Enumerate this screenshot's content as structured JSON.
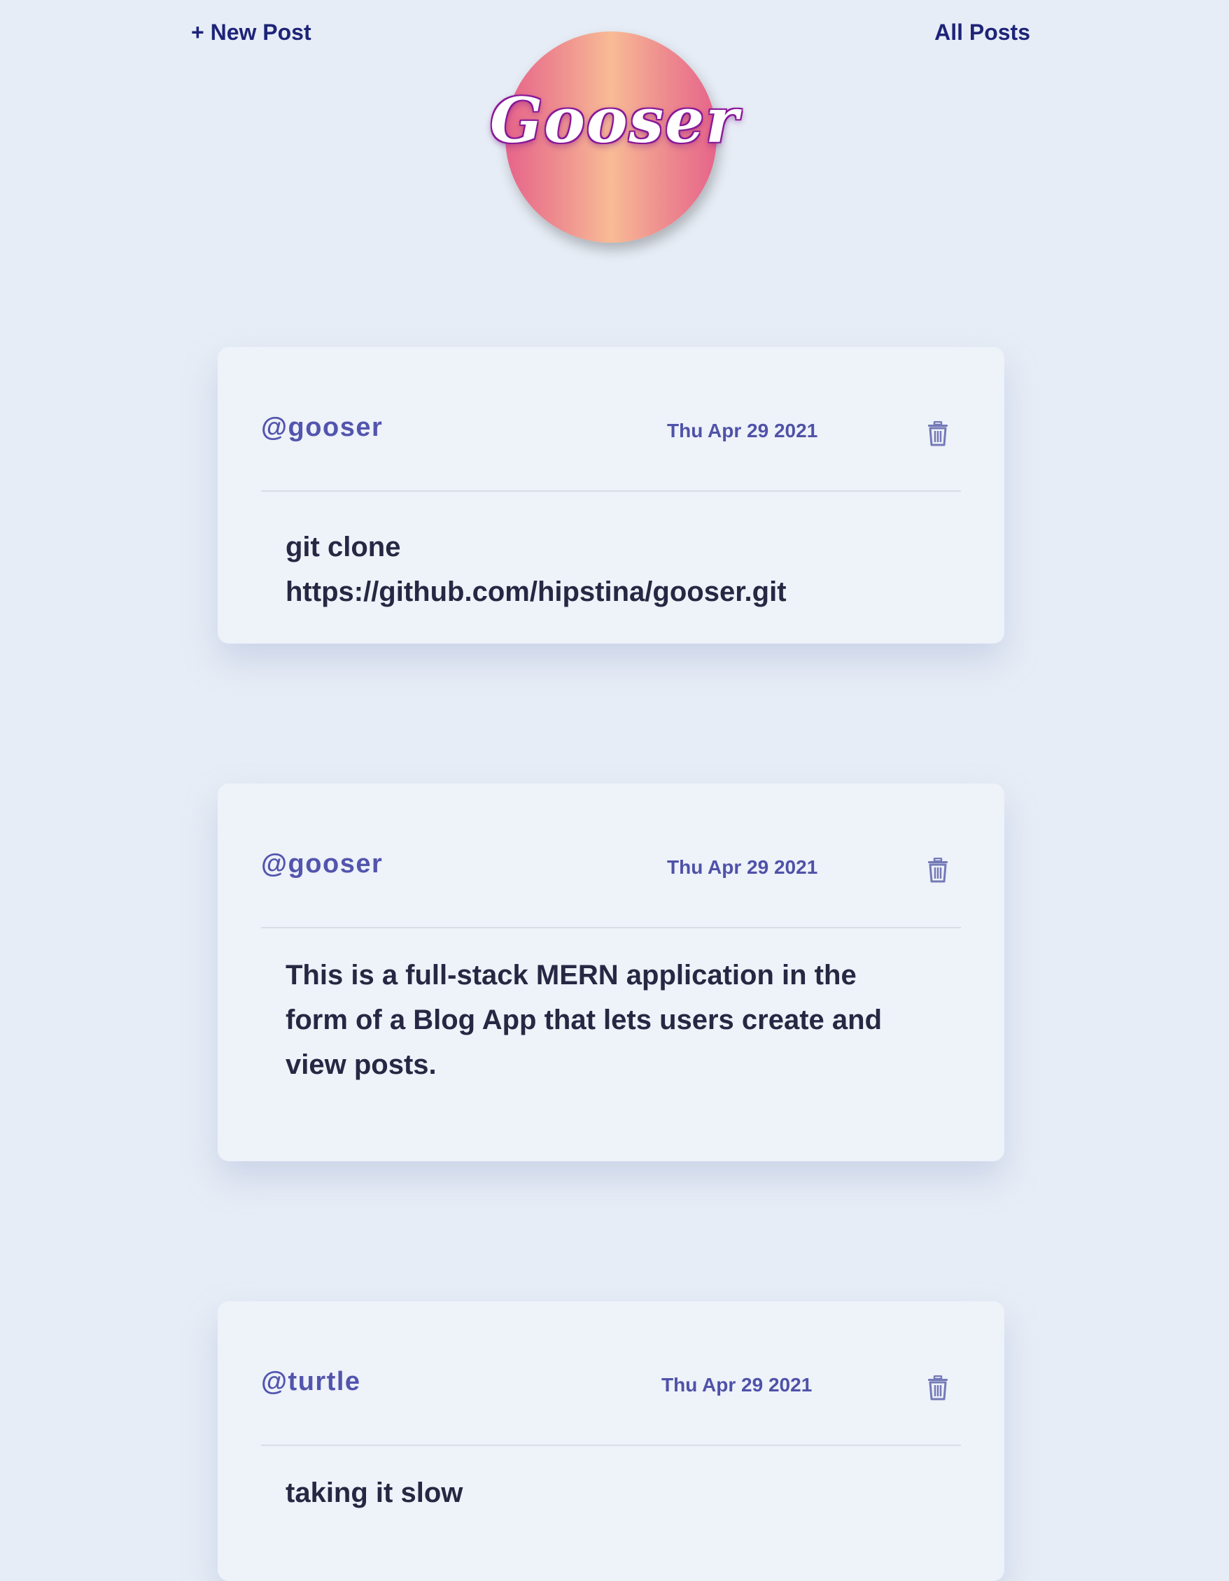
{
  "nav": {
    "new_post": "+ New Post",
    "all_posts": "All Posts"
  },
  "logo": {
    "text": "Gooser"
  },
  "posts": [
    {
      "author": "@gooser",
      "date": "Thu Apr 29 2021",
      "body": "git clone https://github.com/hipstina/gooser.git"
    },
    {
      "author": "@gooser",
      "date": "Thu Apr 29 2021",
      "body": "This is a full-stack MERN application in the form of a Blog App that lets users create and view posts."
    },
    {
      "author": "@turtle",
      "date": "Thu Apr 29 2021",
      "body": "taking it slow"
    }
  ],
  "icons": {
    "delete": "trash-icon"
  },
  "colors": {
    "background": "#e7edf6",
    "card": "#eef2f9",
    "nav_text": "#1e2478",
    "author": "#5255ad",
    "body_text": "#262843",
    "logo_gradient_edge": "#e6648a",
    "logo_gradient_center": "#f8bb95"
  }
}
